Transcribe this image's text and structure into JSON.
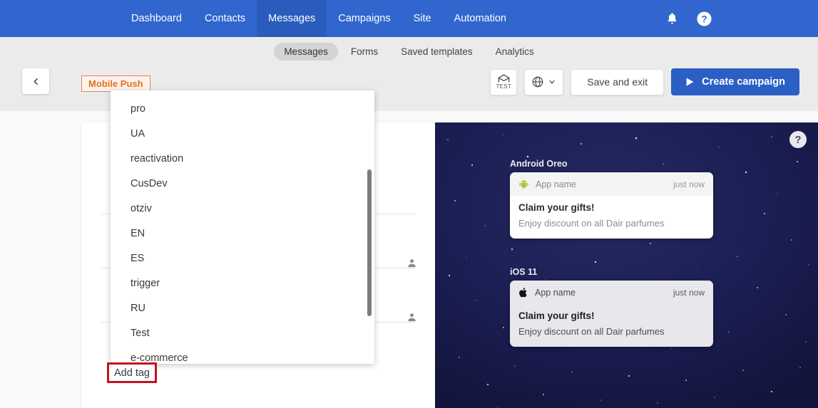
{
  "topnav": {
    "items": [
      {
        "label": "Dashboard",
        "active": false
      },
      {
        "label": "Contacts",
        "active": false
      },
      {
        "label": "Messages",
        "active": true
      },
      {
        "label": "Campaigns",
        "active": false
      },
      {
        "label": "Site",
        "active": false
      },
      {
        "label": "Automation",
        "active": false
      }
    ],
    "bell_icon": "bell-icon",
    "help_icon": "help-circle-icon",
    "background_color": "#3066ce",
    "active_background_color": "#2a5cbd"
  },
  "subnav": {
    "items": [
      {
        "label": "Messages",
        "active": true
      },
      {
        "label": "Forms",
        "active": false
      },
      {
        "label": "Saved templates",
        "active": false
      },
      {
        "label": "Analytics",
        "active": false
      }
    ]
  },
  "toolbar": {
    "back_icon": "chevron-left-icon",
    "channel_tag": "Mobile Push",
    "channel_tag_color": "#e2711d",
    "test_button": {
      "icon": "envelope-open-icon",
      "label": "TEST"
    },
    "language_button": {
      "icon": "globe-icon",
      "chevron": "chevron-down-icon"
    },
    "save_and_exit": "Save and exit",
    "create_campaign": "Create campaign",
    "create_campaign_icon": "play-triangle-icon",
    "create_campaign_color": "#2b5fc4"
  },
  "tag_dropdown": {
    "items": [
      "pro",
      "UA",
      "reactivation",
      "CusDev",
      "otziv",
      "EN",
      "ES",
      "trigger",
      "RU",
      "Test",
      "e-commerce"
    ],
    "add_tag_label": "Add tag",
    "highlight_color": "#c1121f"
  },
  "preview": {
    "help_icon": "help-circle-icon",
    "help_glyph": "?",
    "notifications": [
      {
        "os_label": "Android Oreo",
        "platform_icon": "android-icon",
        "app_name": "App name",
        "time": "just now",
        "title": "Claim your gifts!",
        "text": "Enjoy discount on all Dair parfumes"
      },
      {
        "os_label": "iOS 11",
        "platform_icon": "apple-icon",
        "app_name": "App name",
        "time": "just now",
        "title": "Claim your gifts!",
        "text": "Enjoy discount on all Dair parfumes"
      }
    ],
    "background_color": "#171a4a"
  },
  "editor": {
    "field_icon": "person-icon"
  }
}
